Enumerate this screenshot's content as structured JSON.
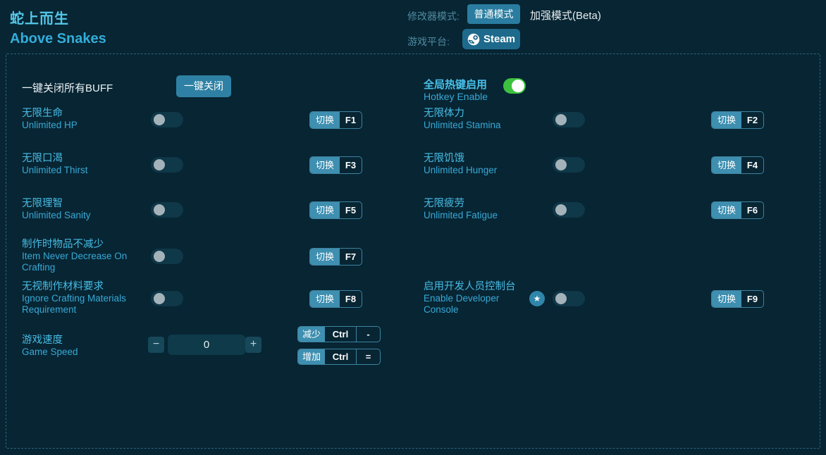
{
  "header": {
    "title_cn": "蛇上而生",
    "title_en": "Above Snakes",
    "mode_label": "修改器模式:",
    "mode_normal": "普通模式",
    "mode_enhanced": "加强模式(Beta)",
    "platform_label": "游戏平台:",
    "platform_steam": "Steam"
  },
  "panel": {
    "buff": {
      "label": "一键关闭所有BUFF",
      "button": "一键关闭"
    },
    "hotkey_enable": {
      "cn": "全局热键启用",
      "en": "Hotkey Enable",
      "state": "on"
    },
    "toggle_label": "切换",
    "cheats": [
      {
        "cn": "无限生命",
        "en": "Unlimited HP",
        "key": "F1",
        "state": "off"
      },
      {
        "cn": "无限体力",
        "en": "Unlimited Stamina",
        "key": "F2",
        "state": "off"
      },
      {
        "cn": "无限口渴",
        "en": "Unlimited Thirst",
        "key": "F3",
        "state": "off"
      },
      {
        "cn": "无限饥饿",
        "en": "Unlimited Hunger",
        "key": "F4",
        "state": "off"
      },
      {
        "cn": "无限理智",
        "en": "Unlimited Sanity",
        "key": "F5",
        "state": "off"
      },
      {
        "cn": "无限疲劳",
        "en": "Unlimited Fatigue",
        "key": "F6",
        "state": "off"
      },
      {
        "cn": "制作时物品不减少",
        "en": "Item Never Decrease On Crafting",
        "key": "F7",
        "state": "off"
      },
      {
        "cn": "无视制作材料要求",
        "en": "Ignore Crafting Materials Requirement",
        "key": "F8",
        "state": "off"
      },
      {
        "cn": "启用开发人员控制台",
        "en": "Enable Developer Console",
        "key": "F9",
        "state": "off",
        "starred": true
      }
    ],
    "speed": {
      "cn": "游戏速度",
      "en": "Game Speed",
      "value": "0",
      "minus": "−",
      "plus": "+",
      "dec": {
        "label": "减少",
        "mod": "Ctrl",
        "key": "-"
      },
      "inc": {
        "label": "增加",
        "mod": "Ctrl",
        "key": "="
      }
    }
  },
  "icons": {
    "star": "★",
    "steam": "steam-logo"
  },
  "colors": {
    "background": "#072533",
    "accent_button": "#2a7da0",
    "hotkey_fill": "#3e8fb0",
    "toggle_on_green": "#3cc13f",
    "label_cyan_cn": "#48bce4",
    "label_cyan_en": "#38a9d6",
    "panel_border": "#2e6579"
  }
}
